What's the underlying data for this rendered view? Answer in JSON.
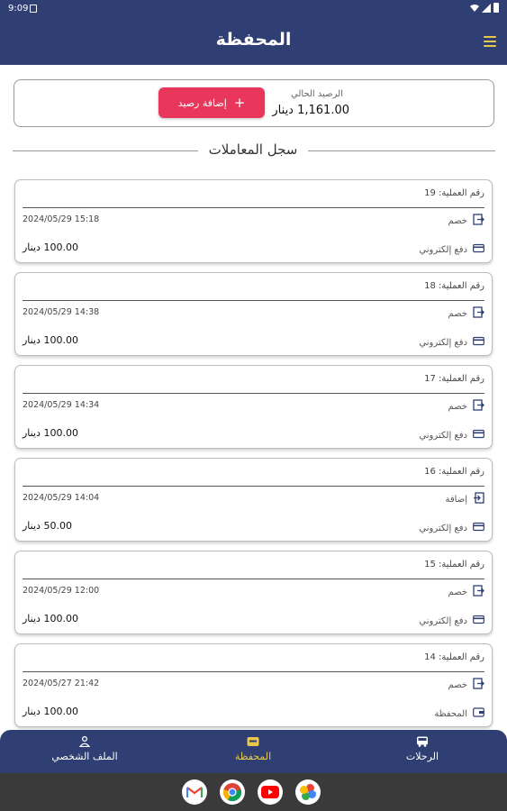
{
  "status_bar": {
    "time": "9:09"
  },
  "app_bar": {
    "title": "المحفظة"
  },
  "balance": {
    "label": "الرصيد الحالي",
    "value": "1,161.00 دينار",
    "add_button_label": "إضافة رصيد"
  },
  "section": {
    "title": "سجل المعاملات"
  },
  "transactions": [
    {
      "id": "رقم العملية: 19",
      "date": "2024/05/29 15:18",
      "type": "خصم",
      "amount": "100.00 دينار",
      "method": "دفع إلكتروني",
      "kind": "debit",
      "method_icon": "card-icon"
    },
    {
      "id": "رقم العملية: 18",
      "date": "2024/05/29 14:38",
      "type": "خصم",
      "amount": "100.00 دينار",
      "method": "دفع إلكتروني",
      "kind": "debit",
      "method_icon": "card-icon"
    },
    {
      "id": "رقم العملية: 17",
      "date": "2024/05/29 14:34",
      "type": "خصم",
      "amount": "100.00 دينار",
      "method": "دفع إلكتروني",
      "kind": "debit",
      "method_icon": "card-icon"
    },
    {
      "id": "رقم العملية: 16",
      "date": "2024/05/29 14:04",
      "type": "إضافة",
      "amount": "50.00 دينار",
      "method": "دفع إلكتروني",
      "kind": "credit",
      "method_icon": "card-icon"
    },
    {
      "id": "رقم العملية: 15",
      "date": "2024/05/29 12:00",
      "type": "خصم",
      "amount": "100.00 دينار",
      "method": "دفع إلكتروني",
      "kind": "debit",
      "method_icon": "card-icon"
    },
    {
      "id": "رقم العملية: 14",
      "date": "2024/05/27 21:42",
      "type": "خصم",
      "amount": "100.00 دينار",
      "method": "المحفظة",
      "kind": "debit",
      "method_icon": "wallet-icon"
    }
  ],
  "bottom_nav": {
    "profile": "الملف الشخصي",
    "wallet": "المحفظة",
    "trips": "الرحلات",
    "active": "wallet"
  },
  "dock": {
    "apps": [
      "gmail-icon",
      "chrome-icon",
      "youtube-icon",
      "photos-icon"
    ]
  },
  "colors": {
    "primary": "#2f3f73",
    "accent": "#e8375a",
    "active_nav": "#e8c84a"
  }
}
